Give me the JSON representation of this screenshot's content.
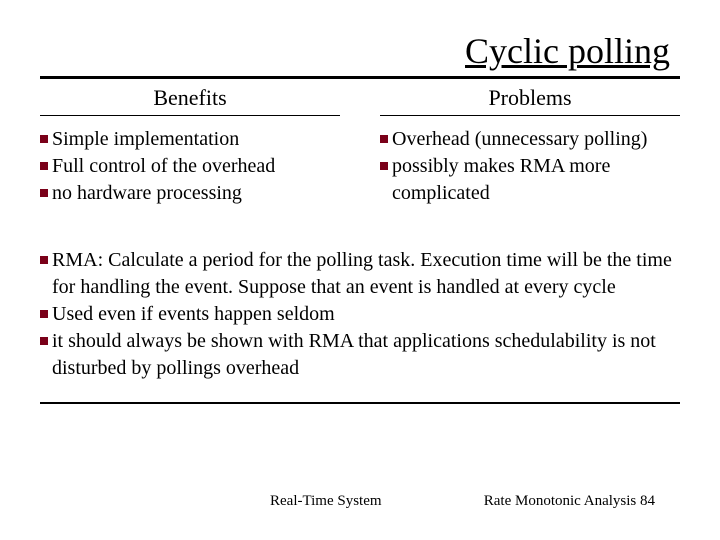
{
  "title": "Cyclic polling",
  "columns": {
    "benefits": {
      "header": "Benefits",
      "items": [
        "Simple implementation",
        "Full control of the overhead",
        "no hardware processing"
      ]
    },
    "problems": {
      "header": "Problems",
      "items": [
        "Overhead (unnecessary polling)",
        "possibly makes RMA more complicated"
      ]
    }
  },
  "notes": [
    "RMA: Calculate a period for the polling task. Execution time will be the time for handling the event. Suppose that an event is handled at every cycle",
    "Used even if events happen seldom",
    "it should always be shown with RMA that applications schedulability is not disturbed by pollings overhead"
  ],
  "footer": {
    "left": "Real-Time System",
    "right": "Rate Monotonic Analysis 84"
  }
}
